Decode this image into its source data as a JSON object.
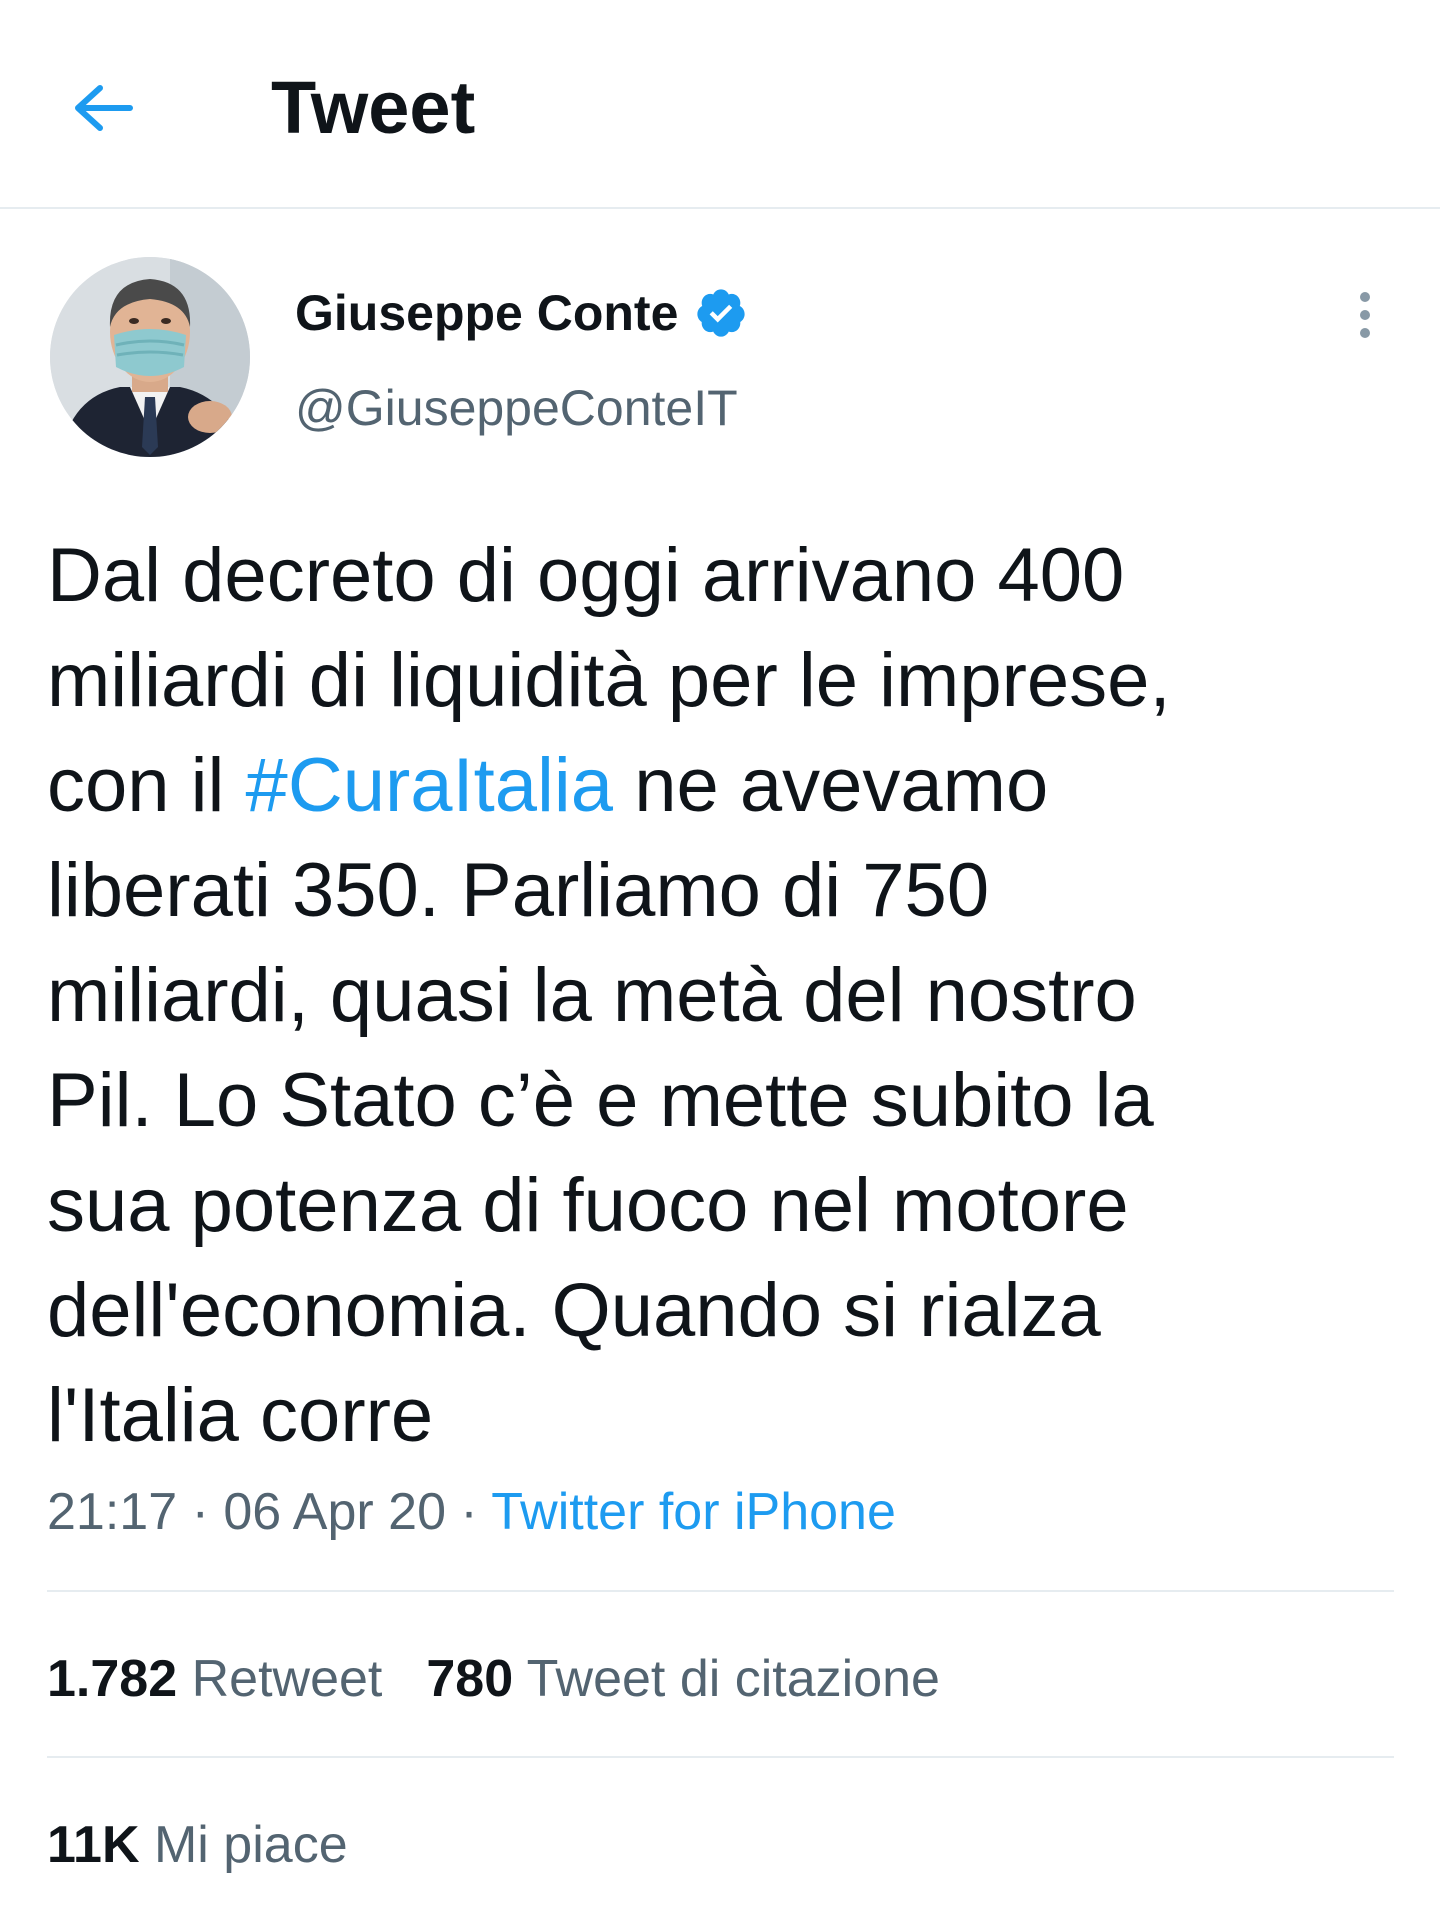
{
  "header": {
    "title": "Tweet"
  },
  "author": {
    "name": "Giuseppe Conte",
    "handle": "@GiuseppeConteIT"
  },
  "tweet": {
    "lines": [
      "Dal decreto di oggi arrivano 400",
      "miliardi di liquidità per le imprese,",
      "con il ",
      "#CuraItalia",
      " ne avevamo",
      "liberati 350. Parliamo di 750",
      "miliardi, quasi la metà del nostro",
      "Pil. Lo Stato c’è e mette subito la",
      "sua potenza di fuoco nel motore",
      "dell'economia. Quando si rialza",
      "l'Italia corre"
    ]
  },
  "meta": {
    "time": "21:17",
    "date": "06 Apr 20",
    "separator": " · ",
    "source": "Twitter for iPhone"
  },
  "stats": {
    "retweets_count": "1.782",
    "retweets_label": "Retweet",
    "quotes_count": "780",
    "quotes_label": "Tweet di citazione",
    "likes_count": "11K",
    "likes_label": "Mi piace"
  },
  "colors": {
    "accent": "#1d9bf0",
    "text": "#0f1419",
    "secondary": "#536471",
    "border": "#e6ecf0"
  },
  "icons": {
    "back": "arrow-left-icon",
    "verified": "verified-badge-icon",
    "more": "more-vertical-icon"
  }
}
